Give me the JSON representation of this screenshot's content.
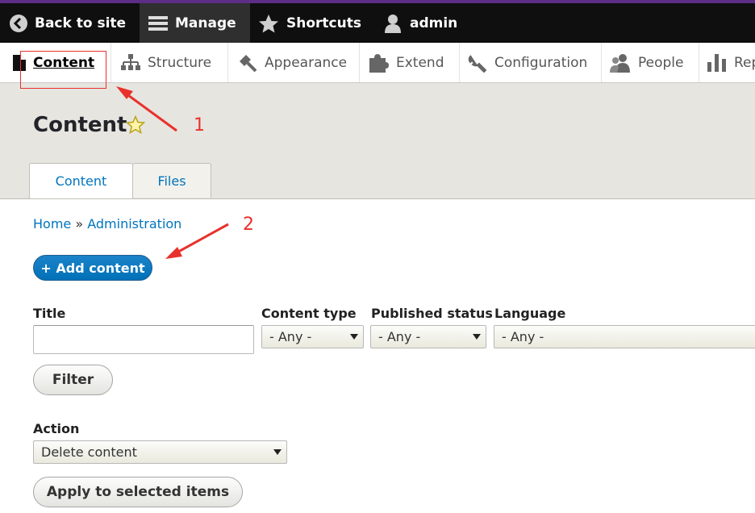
{
  "toolbar": {
    "back_label": "Back to site",
    "manage_label": "Manage",
    "shortcuts_label": "Shortcuts",
    "user_label": "admin"
  },
  "tray": {
    "items": [
      {
        "label": "Content",
        "icon": "file-icon",
        "active": true
      },
      {
        "label": "Structure",
        "icon": "sitemap-icon"
      },
      {
        "label": "Appearance",
        "icon": "paintbrush-icon"
      },
      {
        "label": "Extend",
        "icon": "puzzle-icon"
      },
      {
        "label": "Configuration",
        "icon": "wrench-icon"
      },
      {
        "label": "People",
        "icon": "people-icon"
      },
      {
        "label": "Rep",
        "icon": "bar-chart-icon"
      }
    ]
  },
  "page": {
    "title": "Content",
    "tabs": [
      {
        "label": "Content"
      },
      {
        "label": "Files"
      }
    ],
    "breadcrumb": {
      "home": "Home",
      "separator": "»",
      "admin": "Administration"
    },
    "add_button": "+ Add content"
  },
  "filters": {
    "title_label": "Title",
    "title_value": "",
    "content_type_label": "Content type",
    "content_type_value": "- Any -",
    "published_label": "Published status",
    "published_value": "- Any -",
    "language_label": "Language",
    "language_value": "- Any -",
    "filter_button": "Filter"
  },
  "bulk": {
    "action_label": "Action",
    "action_value": "Delete content",
    "apply_button": "Apply to selected items"
  },
  "annotations": {
    "one": "1",
    "two": "2"
  },
  "colors": {
    "accent": "#0074bd",
    "annotation": "#e8312c",
    "toolbar": "#0f0f0f",
    "purple": "#5b2d86"
  }
}
